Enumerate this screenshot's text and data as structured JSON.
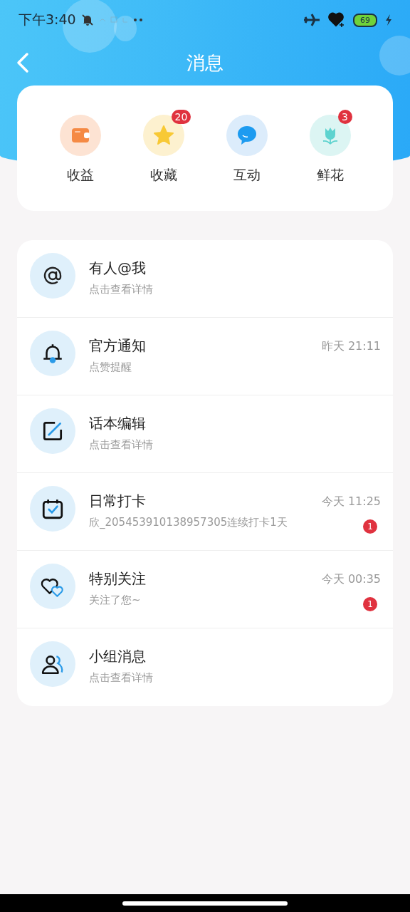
{
  "status_bar": {
    "time": "下午3:40",
    "battery": "69"
  },
  "header": {
    "title": "消息"
  },
  "shortcuts": [
    {
      "kind": "wallet",
      "label": "收益"
    },
    {
      "kind": "star",
      "label": "收藏",
      "badge": "20"
    },
    {
      "kind": "chat",
      "label": "互动"
    },
    {
      "kind": "flower",
      "label": "鲜花",
      "badge": "3"
    }
  ],
  "messages": [
    {
      "kind": "at",
      "title": "有人@我",
      "subtitle": "点击查看详情"
    },
    {
      "kind": "bell",
      "title": "官方通知",
      "subtitle": "点赞提醒",
      "time": "昨天 21:11"
    },
    {
      "kind": "edit",
      "title": "话本编辑",
      "subtitle": "点击查看详情"
    },
    {
      "kind": "calendar",
      "title": "日常打卡",
      "subtitle": "欣_205453910138957305连续打卡1天",
      "time": "今天 11:25",
      "badge": "1"
    },
    {
      "kind": "hearts",
      "title": "特别关注",
      "subtitle": "关注了您~",
      "time": "今天 00:35",
      "badge": "1"
    },
    {
      "kind": "group",
      "title": "小组消息",
      "subtitle": "点击查看详情"
    }
  ]
}
